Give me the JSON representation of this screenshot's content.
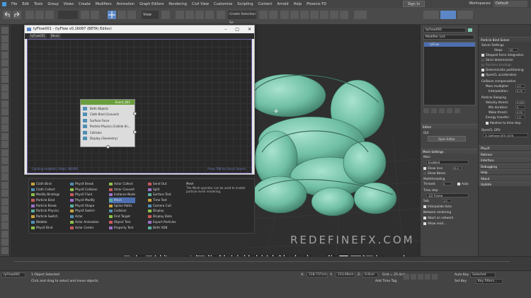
{
  "menu": {
    "items": [
      "File",
      "Edit",
      "Tools",
      "Group",
      "Views",
      "Create",
      "Modifiers",
      "Animation",
      "Graph Editors",
      "Rendering",
      "Civil View",
      "Customize",
      "Scripting",
      "Content",
      "Arnold",
      "Help",
      "Phoenix FD"
    ],
    "sign_in": "Sign In",
    "workspaces_label": "Workspaces:",
    "workspace_value": "Default"
  },
  "toolbar": {
    "view_dropdown": "View",
    "selection_set": "Create Selection Se"
  },
  "tyflow_window": {
    "title": "tyFlow001 - (tyFlow v0.16087 (BETA) Editor)",
    "tabs": [
      "tyFlow001",
      "[New]"
    ],
    "status_left": "Caching enabled | Static: NEVER",
    "status_right": "Press TAB for Quick Search",
    "node": {
      "title": "Event_001",
      "rows": [
        "Birth Objects",
        "Cloth Bind (Convert)",
        "Surface Force",
        "Particle Physics (Collide (In...",
        "Collision",
        "Display (Geometry)"
      ]
    }
  },
  "palette": {
    "col1": [
      "Cloth Bind",
      "Cloth Collect",
      "Modify Bindings",
      "Particle Bind",
      "Particle Break",
      "Particle Physics",
      "Particle Switch",
      "Wobble",
      "PhysX Bind"
    ],
    "col2": [
      "PhysX Break",
      "PhysX Collision",
      "PhysX Fluid",
      "PhysX Modify",
      "PhysX Shape",
      "PhysX Switch",
      "Actor",
      "Actor Animation",
      "Actor Center"
    ],
    "col3": [
      "Actor Collect",
      "Actor Convert",
      "Instance Node",
      "Mesh",
      "Spline Paths",
      "Collision",
      "Find Target",
      "Object Test",
      "Property Test"
    ],
    "col4": [
      "Send Out",
      "Split",
      "Surface Test",
      "Time Test",
      "Camera Cull",
      "Display",
      "Display Data",
      "Export Particles",
      "Birth VDB"
    ],
    "selected": "Mesh",
    "help_title": "Mesh",
    "help_text": "The Mesh operator can be used to enable particle mesh rendering."
  },
  "command_panel": {
    "object_name": "tyFlow001",
    "modifier_list": "Modifier List",
    "stack_item": "tyFlow",
    "editor_header": "Editor",
    "gui_label": "GUI",
    "open_editor": "Open Editor",
    "mesh_settings": "Mesh Settings",
    "main_label": "Main",
    "enabled_label": "Enabled",
    "show_icon": "Show Icon",
    "show_icon_value": "25.0",
    "show_name": "Show Name",
    "multithreading": "Multithreading",
    "threads_label": "Threads",
    "threads_value": "0",
    "auto": "Auto",
    "time_step_label": "Time step",
    "time_step_value": "1/2 Frame",
    "sub_label": "Sub",
    "sub_value": "1.0",
    "interpolate": "Interpolate ticks",
    "network_rendering": "Network rendering",
    "abort_on": "Abort on network",
    "allow_rendering": "Allow rend..."
  },
  "right_panel": {
    "header": "Particle Bind Solver",
    "solver_settings": "Solver Settings",
    "steps_label": "Steps",
    "steps_value": "20",
    "stepped_force": "Stepped force integration",
    "strict_determinism": "Strict determinism",
    "random_bindings": "Random bindings",
    "deterministic_partitioning": "Deterministic partitioning",
    "opencl": "OpenCL acceleration",
    "collision_comp": "Collision compensation",
    "mass_multiplier": "Mass multiplier:",
    "mass_value": "1.0",
    "interpolation": "Interpolation:",
    "interp_value": "0.75",
    "particle_sleeping": "Particle Sleeping",
    "velocity_thresh": "Velocity thresh:",
    "velocity_value": "0.025",
    "min_duration": "Min duration:",
    "min_value": "5",
    "wake_thresh": "Wake thresh:",
    "wake_value": "0.25",
    "energy_transfer": "Energy transfer:",
    "energy_value": "1.0",
    "relative_to_time": "Relative to time step",
    "opencl_gpu": "OpenCL GPU",
    "gpu_value": "3: GeForce GTX 1070",
    "rollouts": [
      "PhysX",
      "Retimer",
      "Interface",
      "Debugging",
      "Help",
      "About",
      "Update"
    ]
  },
  "viewport": {
    "watermark": "REDEFINEFX.COM"
  },
  "subtitle": "几何形状，以便您能够将其渲染出来，您需要添加一个",
  "status": {
    "script_tab": "tyFlow001",
    "selected": "1 Object Selected",
    "hint": "Click and drag to select and move objects",
    "x": "218.737cm",
    "y": "153.69cm",
    "z": "0.0cm",
    "grid": "Grid = 25.4cm",
    "add_time_tag": "Add Time Tag",
    "auto_key": "Auto Key",
    "set_key": "Set Key",
    "selected_dd": "Selected",
    "key_filters": "Key Filters..."
  },
  "colors": {
    "node_header": "#6b9e3e",
    "palette_select": "#4d6fb0",
    "mesh_color": "#7fc9b0"
  }
}
